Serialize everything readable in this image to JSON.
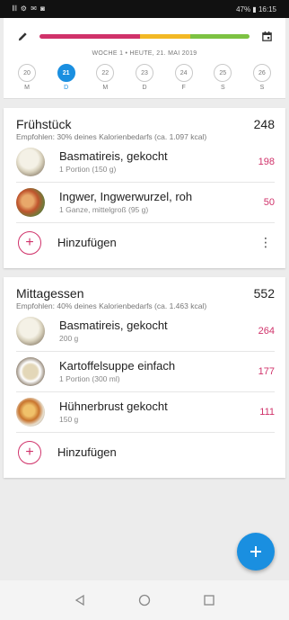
{
  "status_bar": {
    "left": "𝄃𝄃 ⚙ ✉ ◙",
    "right": "47% ▮ 16:15"
  },
  "colors": {
    "accent": "#1a8fe0",
    "kcal": "#d0326a",
    "bar_red": "#d0326a",
    "bar_yellow": "#f2b824",
    "bar_green": "#7dc242"
  },
  "header": {
    "week_line": "WOCHE 1 • HEUTE, 21. MAI 2019",
    "days": [
      {
        "num": "20",
        "label": "M"
      },
      {
        "num": "21",
        "label": "D",
        "selected": true
      },
      {
        "num": "22",
        "label": "M"
      },
      {
        "num": "23",
        "label": "D"
      },
      {
        "num": "24",
        "label": "F"
      },
      {
        "num": "25",
        "label": "S"
      },
      {
        "num": "26",
        "label": "S"
      }
    ]
  },
  "breakfast": {
    "title": "Frühstück",
    "total": "248",
    "recommend": "Empfohlen: 30% deines Kalorienbedarfs (ca. 1.097 kcal)",
    "items": [
      {
        "name": "Basmatireis, gekocht",
        "amount": "1 Portion (150 g)",
        "kcal": "198"
      },
      {
        "name": "Ingwer, Ingwerwurzel, roh",
        "amount": "1 Ganze, mittelgroß (95 g)",
        "kcal": "50"
      }
    ],
    "add_label": "Hinzufügen"
  },
  "lunch": {
    "title": "Mittagessen",
    "total": "552",
    "recommend": "Empfohlen: 40% deines Kalorienbedarfs (ca. 1.463 kcal)",
    "items": [
      {
        "name": "Basmatireis, gekocht",
        "amount": "200 g",
        "kcal": "264"
      },
      {
        "name": "Kartoffelsuppe einfach",
        "amount": "1 Portion (300 ml)",
        "kcal": "177"
      },
      {
        "name": "Hühnerbrust gekocht",
        "amount": "150 g",
        "kcal": "111"
      }
    ],
    "add_label": "Hinzufügen"
  },
  "icons": {
    "edit": "pencil-icon",
    "calendar": "calendar-icon",
    "more": "more-vert-icon",
    "fab": "plus-icon"
  }
}
